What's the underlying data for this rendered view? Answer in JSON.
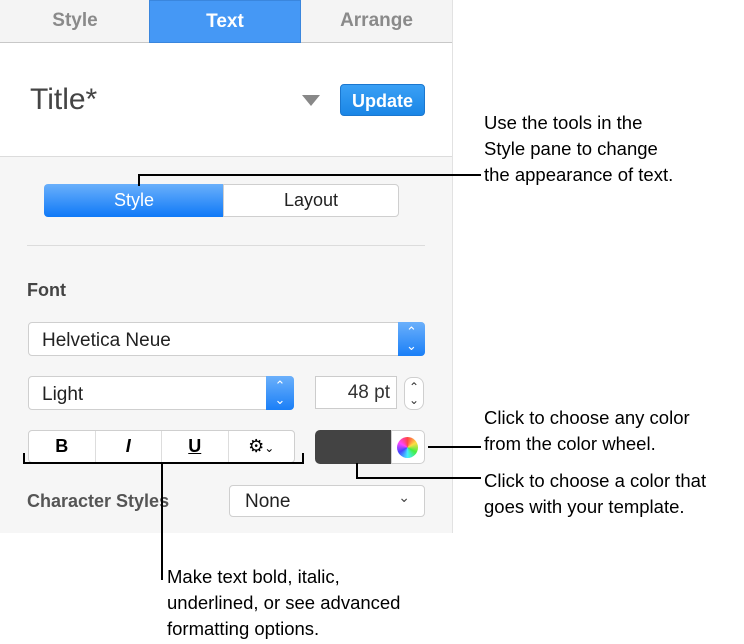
{
  "tabs": [
    "Style",
    "Text",
    "Arrange"
  ],
  "paragraph_style": {
    "name": "Title*",
    "update_label": "Update"
  },
  "segmented": {
    "style": "Style",
    "layout": "Layout"
  },
  "font": {
    "section_label": "Font",
    "family": "Helvetica Neue",
    "typeface": "Light",
    "size": "48 pt"
  },
  "format_buttons": {
    "bold": "B",
    "italic": "I",
    "underline": "U"
  },
  "text_color": "#434343",
  "character_styles": {
    "label": "Character Styles",
    "value": "None"
  },
  "callouts": {
    "style_pane": [
      "Use the tools in the",
      "Style pane to change",
      "the appearance of text."
    ],
    "color_wheel": [
      "Click to choose any color",
      "from the color wheel."
    ],
    "color_well": [
      "Click to choose a color that",
      "goes with your template."
    ],
    "format": [
      "Make text bold, italic,",
      "underlined, or see advanced",
      "formatting options."
    ]
  }
}
